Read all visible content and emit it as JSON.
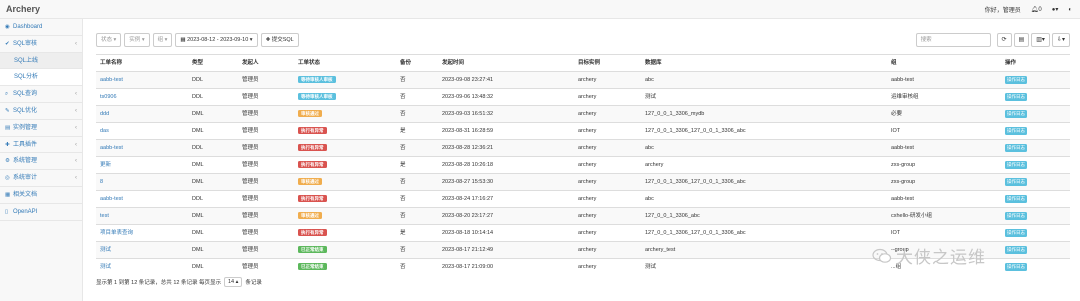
{
  "app": {
    "title": "Archery"
  },
  "topbar": {
    "greeting": "你好，管理员",
    "bell_count": "0",
    "user_caret": "▾",
    "github": "github"
  },
  "sidebar": {
    "items": [
      {
        "label": "Dashboard",
        "icon": "dashboard-icon",
        "glyph": "◉",
        "chev": ""
      },
      {
        "label": "SQL审核",
        "icon": "check-icon",
        "glyph": "✔",
        "chev": "‹"
      },
      {
        "label": "SQL上线",
        "sub": true,
        "active": true,
        "chev": ""
      },
      {
        "label": "SQL分析",
        "sub": true,
        "chev": ""
      },
      {
        "label": "SQL查询",
        "icon": "search-icon",
        "glyph": "⌕",
        "chev": "‹"
      },
      {
        "label": "SQL优化",
        "icon": "wrench-icon",
        "glyph": "✎",
        "chev": "‹"
      },
      {
        "label": "实例管理",
        "icon": "server-icon",
        "glyph": "▤",
        "chev": "‹"
      },
      {
        "label": "工具插件",
        "icon": "plugin-icon",
        "glyph": "✚",
        "chev": "‹"
      },
      {
        "label": "系统管理",
        "icon": "gear-icon",
        "glyph": "⚙",
        "chev": "‹"
      },
      {
        "label": "系统审计",
        "icon": "eye-icon",
        "glyph": "◎",
        "chev": "‹"
      },
      {
        "label": "相关文档",
        "icon": "book-icon",
        "glyph": "▦",
        "chev": ""
      },
      {
        "label": "OpenAPI",
        "icon": "api-icon",
        "glyph": "▯",
        "chev": ""
      }
    ]
  },
  "toolbar": {
    "status_label": "状态 ▾",
    "instance_label": "实例 ▾",
    "group_label": "组 ▾",
    "date_range": "2023-08-12 - 2023-09-10 ▾",
    "submit_label": "提交SQL",
    "search_placeholder": "搜索"
  },
  "table": {
    "headers": [
      "工单名称",
      "类型",
      "发起人",
      "工单状态",
      "备份",
      "发起时间",
      "目标实例",
      "数据库",
      "组",
      "操作"
    ],
    "action_label": "操作日志",
    "rows": [
      {
        "name": "aabb-test",
        "type": "DDL",
        "user": "管理员",
        "status": "等待审核人审核",
        "status_color": "#5bc0de",
        "backup": "否",
        "time": "2023-09-08 23:27:41",
        "instance": "archery",
        "db": "abc",
        "group": "aabb-test"
      },
      {
        "name": "ts0906",
        "type": "DDL",
        "user": "管理员",
        "status": "等待审核人审核",
        "status_color": "#5bc0de",
        "backup": "否",
        "time": "2023-09-06 13:48:32",
        "instance": "archery",
        "db": "测试",
        "group": "运维审核组"
      },
      {
        "name": "ddd",
        "type": "DML",
        "user": "管理员",
        "status": "审核通过",
        "status_color": "#f0ad4e",
        "backup": "否",
        "time": "2023-09-03 16:51:32",
        "instance": "archery",
        "db": "127_0_0_1_3306_mydb",
        "group": "必要"
      },
      {
        "name": "das",
        "type": "DML",
        "user": "管理员",
        "status": "执行有异常",
        "status_color": "#d9534f",
        "backup": "是",
        "time": "2023-08-31 16:28:59",
        "instance": "archery",
        "db": "127_0_0_1_3306_127_0_0_1_3306_abc",
        "group": "IOT"
      },
      {
        "name": "aabb-test",
        "type": "DDL",
        "user": "管理员",
        "status": "执行有异常",
        "status_color": "#d9534f",
        "backup": "否",
        "time": "2023-08-28 12:36:21",
        "instance": "archery",
        "db": "abc",
        "group": "aabb-test"
      },
      {
        "name": "更新",
        "type": "DML",
        "user": "管理员",
        "status": "执行有异常",
        "status_color": "#d9534f",
        "backup": "是",
        "time": "2023-08-28 10:26:18",
        "instance": "archery",
        "db": "archery",
        "group": "zxs-group"
      },
      {
        "name": "8",
        "type": "DML",
        "user": "管理员",
        "status": "审核通过",
        "status_color": "#f0ad4e",
        "backup": "否",
        "time": "2023-08-27 15:53:30",
        "instance": "archery",
        "db": "127_0_0_1_3306_127_0_0_1_3306_abc",
        "group": "zxs-group"
      },
      {
        "name": "aabb-test",
        "type": "DDL",
        "user": "管理员",
        "status": "执行有异常",
        "status_color": "#d9534f",
        "backup": "否",
        "time": "2023-08-24 17:16:27",
        "instance": "archery",
        "db": "abc",
        "group": "aabb-test"
      },
      {
        "name": "test",
        "type": "DML",
        "user": "管理员",
        "status": "审核通过",
        "status_color": "#f0ad4e",
        "backup": "否",
        "time": "2023-08-20 23:17:27",
        "instance": "archery",
        "db": "127_0_0_1_3306_abc",
        "group": "cxhello-研发小组"
      },
      {
        "name": "项目单表查询",
        "type": "DML",
        "user": "管理员",
        "status": "执行有异常",
        "status_color": "#d9534f",
        "backup": "是",
        "time": "2023-08-18 10:14:14",
        "instance": "archery",
        "db": "127_0_0_1_3306_127_0_0_1_3306_abc",
        "group": "IOT"
      },
      {
        "name": "测试",
        "type": "DML",
        "user": "管理员",
        "status": "已正常结束",
        "status_color": "#5cb85c",
        "backup": "否",
        "time": "2023-08-17 21:12:49",
        "instance": "archery",
        "db": "archery_test",
        "group": "--group"
      },
      {
        "name": "测试",
        "type": "DML",
        "user": "管理员",
        "status": "已正常结束",
        "status_color": "#5cb85c",
        "backup": "否",
        "time": "2023-08-17 21:09:00",
        "instance": "archery",
        "db": "测试",
        "group": "...组"
      }
    ]
  },
  "footer": {
    "summary": "显示第 1 到第 12 条记录，总共 12 条记录  每页显示",
    "page_size": "14 ▴",
    "suffix": "条记录"
  },
  "watermark": {
    "text": "大侠之运维"
  }
}
